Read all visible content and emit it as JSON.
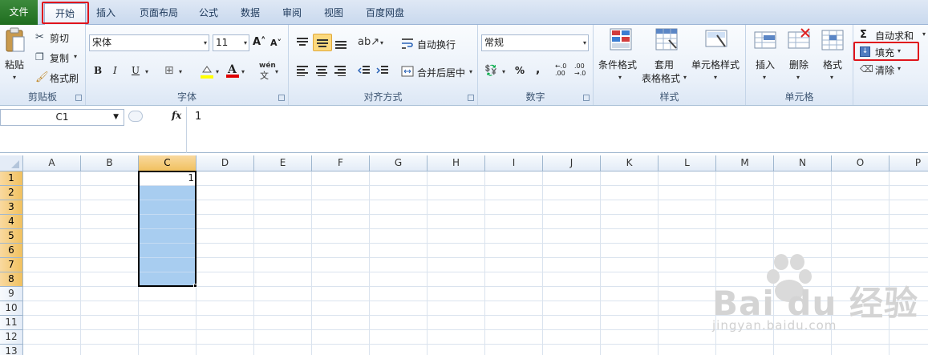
{
  "tabs": [
    "文件",
    "开始",
    "插入",
    "页面布局",
    "公式",
    "数据",
    "审阅",
    "视图",
    "百度网盘"
  ],
  "clipboard": {
    "paste": "粘贴",
    "cut": "剪切",
    "copy": "复制",
    "format_painter": "格式刷",
    "label": "剪贴板"
  },
  "font": {
    "name": "宋体",
    "size": "11",
    "bold": "B",
    "italic": "I",
    "underline": "U",
    "label": "字体",
    "phonetic": "wén"
  },
  "alignment": {
    "wrap_text": "自动换行",
    "merge_center": "合并后居中",
    "label": "对齐方式"
  },
  "number": {
    "format": "常规",
    "percent": "%",
    "comma": ",",
    "label": "数字"
  },
  "styles": {
    "conditional": "条件格式",
    "table_format": "套用\n表格格式",
    "table_format_line1": "套用",
    "table_format_line2": "表格格式",
    "cell_styles": "单元格样式",
    "label": "样式"
  },
  "cells": {
    "insert": "插入",
    "delete": "删除",
    "format": "格式",
    "label": "单元格"
  },
  "editing": {
    "autosum": "自动求和",
    "fill": "填充",
    "clear": "清除"
  },
  "formula_bar": {
    "name_box": "C1",
    "fx": "fx",
    "content": "1"
  },
  "columns": [
    "A",
    "B",
    "C",
    "D",
    "E",
    "F",
    "G",
    "H",
    "I",
    "J",
    "K",
    "L",
    "M",
    "N",
    "O",
    "P"
  ],
  "rows": [
    "1",
    "2",
    "3",
    "4",
    "5",
    "6",
    "7",
    "8",
    "9",
    "10",
    "11",
    "12",
    "13"
  ],
  "cell_values": {
    "C1": "1"
  },
  "selection": {
    "range": "C1:C8",
    "active": "C1"
  },
  "watermark": {
    "brand": "Bai du 经验",
    "url": "jingyan.baidu.com"
  },
  "colors": {
    "accent_green": "#2a7a2a",
    "highlight_red": "#e0141c",
    "selection_blue": "#a8cdf0",
    "header_selected": "#f1c15f"
  }
}
